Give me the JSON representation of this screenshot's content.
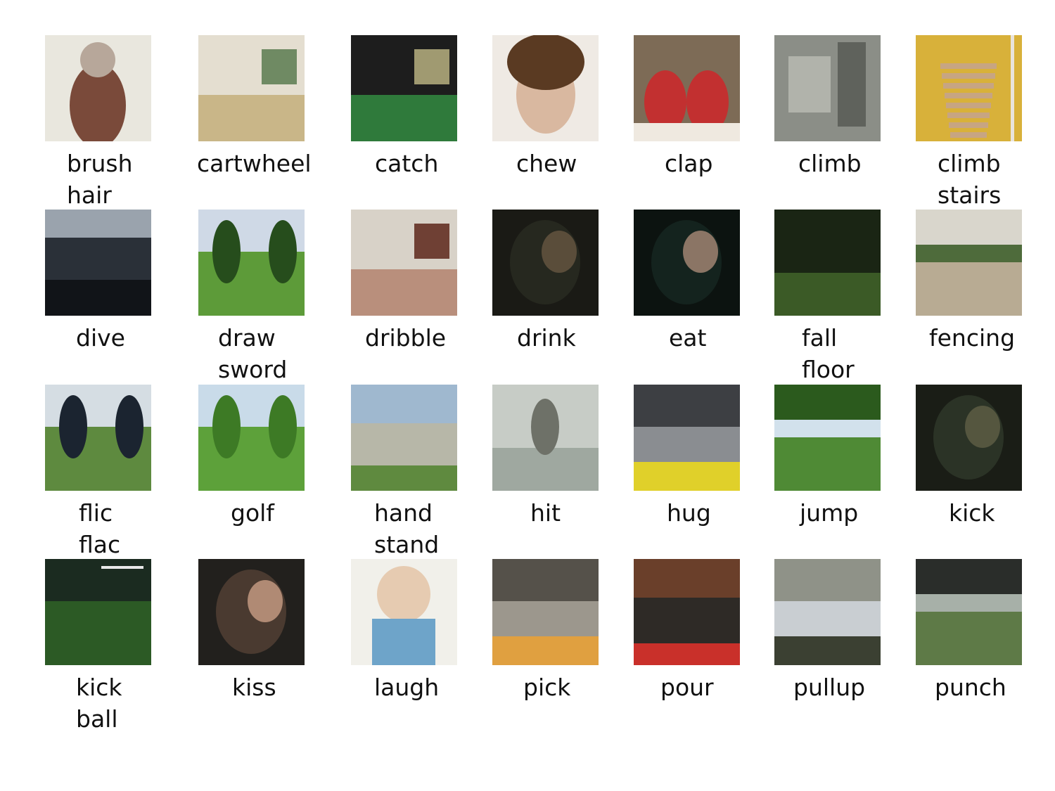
{
  "items": [
    {
      "label": "brush\nhair",
      "scene": "indoor-wall",
      "palette": [
        "#e9e7de",
        "#b7a79a",
        "#7a4a3a"
      ]
    },
    {
      "label": "cartwheel",
      "scene": "gym",
      "palette": [
        "#c9b688",
        "#6f8a63",
        "#e4ded0"
      ]
    },
    {
      "label": "catch",
      "scene": "gym",
      "palette": [
        "#2f7a3b",
        "#a09a71",
        "#1d1d1d"
      ]
    },
    {
      "label": "chew",
      "scene": "face",
      "palette": [
        "#d9b8a0",
        "#5a3a22",
        "#efeae4"
      ]
    },
    {
      "label": "clap",
      "scene": "people",
      "palette": [
        "#7d6b56",
        "#c23030",
        "#efe9e0"
      ]
    },
    {
      "label": "climb",
      "scene": "rock",
      "palette": [
        "#8b8e87",
        "#5f625c",
        "#b1b3ab"
      ]
    },
    {
      "label": "climb\nstairs",
      "scene": "stairs",
      "palette": [
        "#c7a582",
        "#e9e4dc",
        "#d8b13a"
      ]
    },
    {
      "label": "dive",
      "scene": "dark-sky",
      "palette": [
        "#2a3038",
        "#9aa3ad",
        "#111418"
      ]
    },
    {
      "label": "draw\nsword",
      "scene": "grass",
      "palette": [
        "#5d9b39",
        "#264d1c",
        "#cfd9e6"
      ]
    },
    {
      "label": "dribble",
      "scene": "gym",
      "palette": [
        "#b98f7c",
        "#6f4034",
        "#d8d2c8"
      ]
    },
    {
      "label": "drink",
      "scene": "dark",
      "palette": [
        "#26281f",
        "#5a4d3a",
        "#1a1a15"
      ]
    },
    {
      "label": "eat",
      "scene": "dark",
      "palette": [
        "#14231e",
        "#8b7565",
        "#0c1310"
      ]
    },
    {
      "label": "fall\nfloor",
      "scene": "dark-grass",
      "palette": [
        "#1a2514",
        "#3b5a26",
        "#0e150b"
      ]
    },
    {
      "label": "fencing",
      "scene": "field",
      "palette": [
        "#b8ab93",
        "#4e6b3b",
        "#d9d6cc"
      ]
    },
    {
      "label": "flic\nflac",
      "scene": "grass",
      "palette": [
        "#5e8a3f",
        "#1b2430",
        "#d5dde3"
      ]
    },
    {
      "label": "golf",
      "scene": "grass",
      "palette": [
        "#5da13a",
        "#3d7a25",
        "#c9dbe9"
      ]
    },
    {
      "label": "hand\nstand",
      "scene": "beach",
      "palette": [
        "#b7b7a8",
        "#5f8a3f",
        "#9fb8cf"
      ]
    },
    {
      "label": "hit",
      "scene": "blurry",
      "palette": [
        "#9fa8a0",
        "#6e7168",
        "#c7ccc6"
      ]
    },
    {
      "label": "hug",
      "scene": "street",
      "palette": [
        "#3d3f43",
        "#e0d02a",
        "#8a8d91"
      ]
    },
    {
      "label": "jump",
      "scene": "field",
      "palette": [
        "#4f8a35",
        "#d2e1ec",
        "#2b5a1d"
      ]
    },
    {
      "label": "kick",
      "scene": "dark",
      "palette": [
        "#2b3326",
        "#55563f",
        "#1a1d16"
      ]
    },
    {
      "label": "kick\nball",
      "scene": "soccer",
      "palette": [
        "#2c5a25",
        "#e8e8e8",
        "#8a1d2a"
      ]
    },
    {
      "label": "kiss",
      "scene": "dark",
      "palette": [
        "#4a3a30",
        "#b08a74",
        "#22201d"
      ]
    },
    {
      "label": "laugh",
      "scene": "baby",
      "palette": [
        "#e6cbb1",
        "#6ea4c9",
        "#f1f0ea"
      ]
    },
    {
      "label": "pick",
      "scene": "street",
      "palette": [
        "#55514a",
        "#e0a040",
        "#9c978d"
      ]
    },
    {
      "label": "pour",
      "scene": "bar",
      "palette": [
        "#6a3f2a",
        "#c9302a",
        "#2e2a26"
      ]
    },
    {
      "label": "pullup",
      "scene": "street",
      "palette": [
        "#8f9288",
        "#3b4032",
        "#c9ced2"
      ]
    },
    {
      "label": "punch",
      "scene": "field",
      "palette": [
        "#5e7a47",
        "#a7b0a8",
        "#2a2d2a"
      ]
    }
  ]
}
